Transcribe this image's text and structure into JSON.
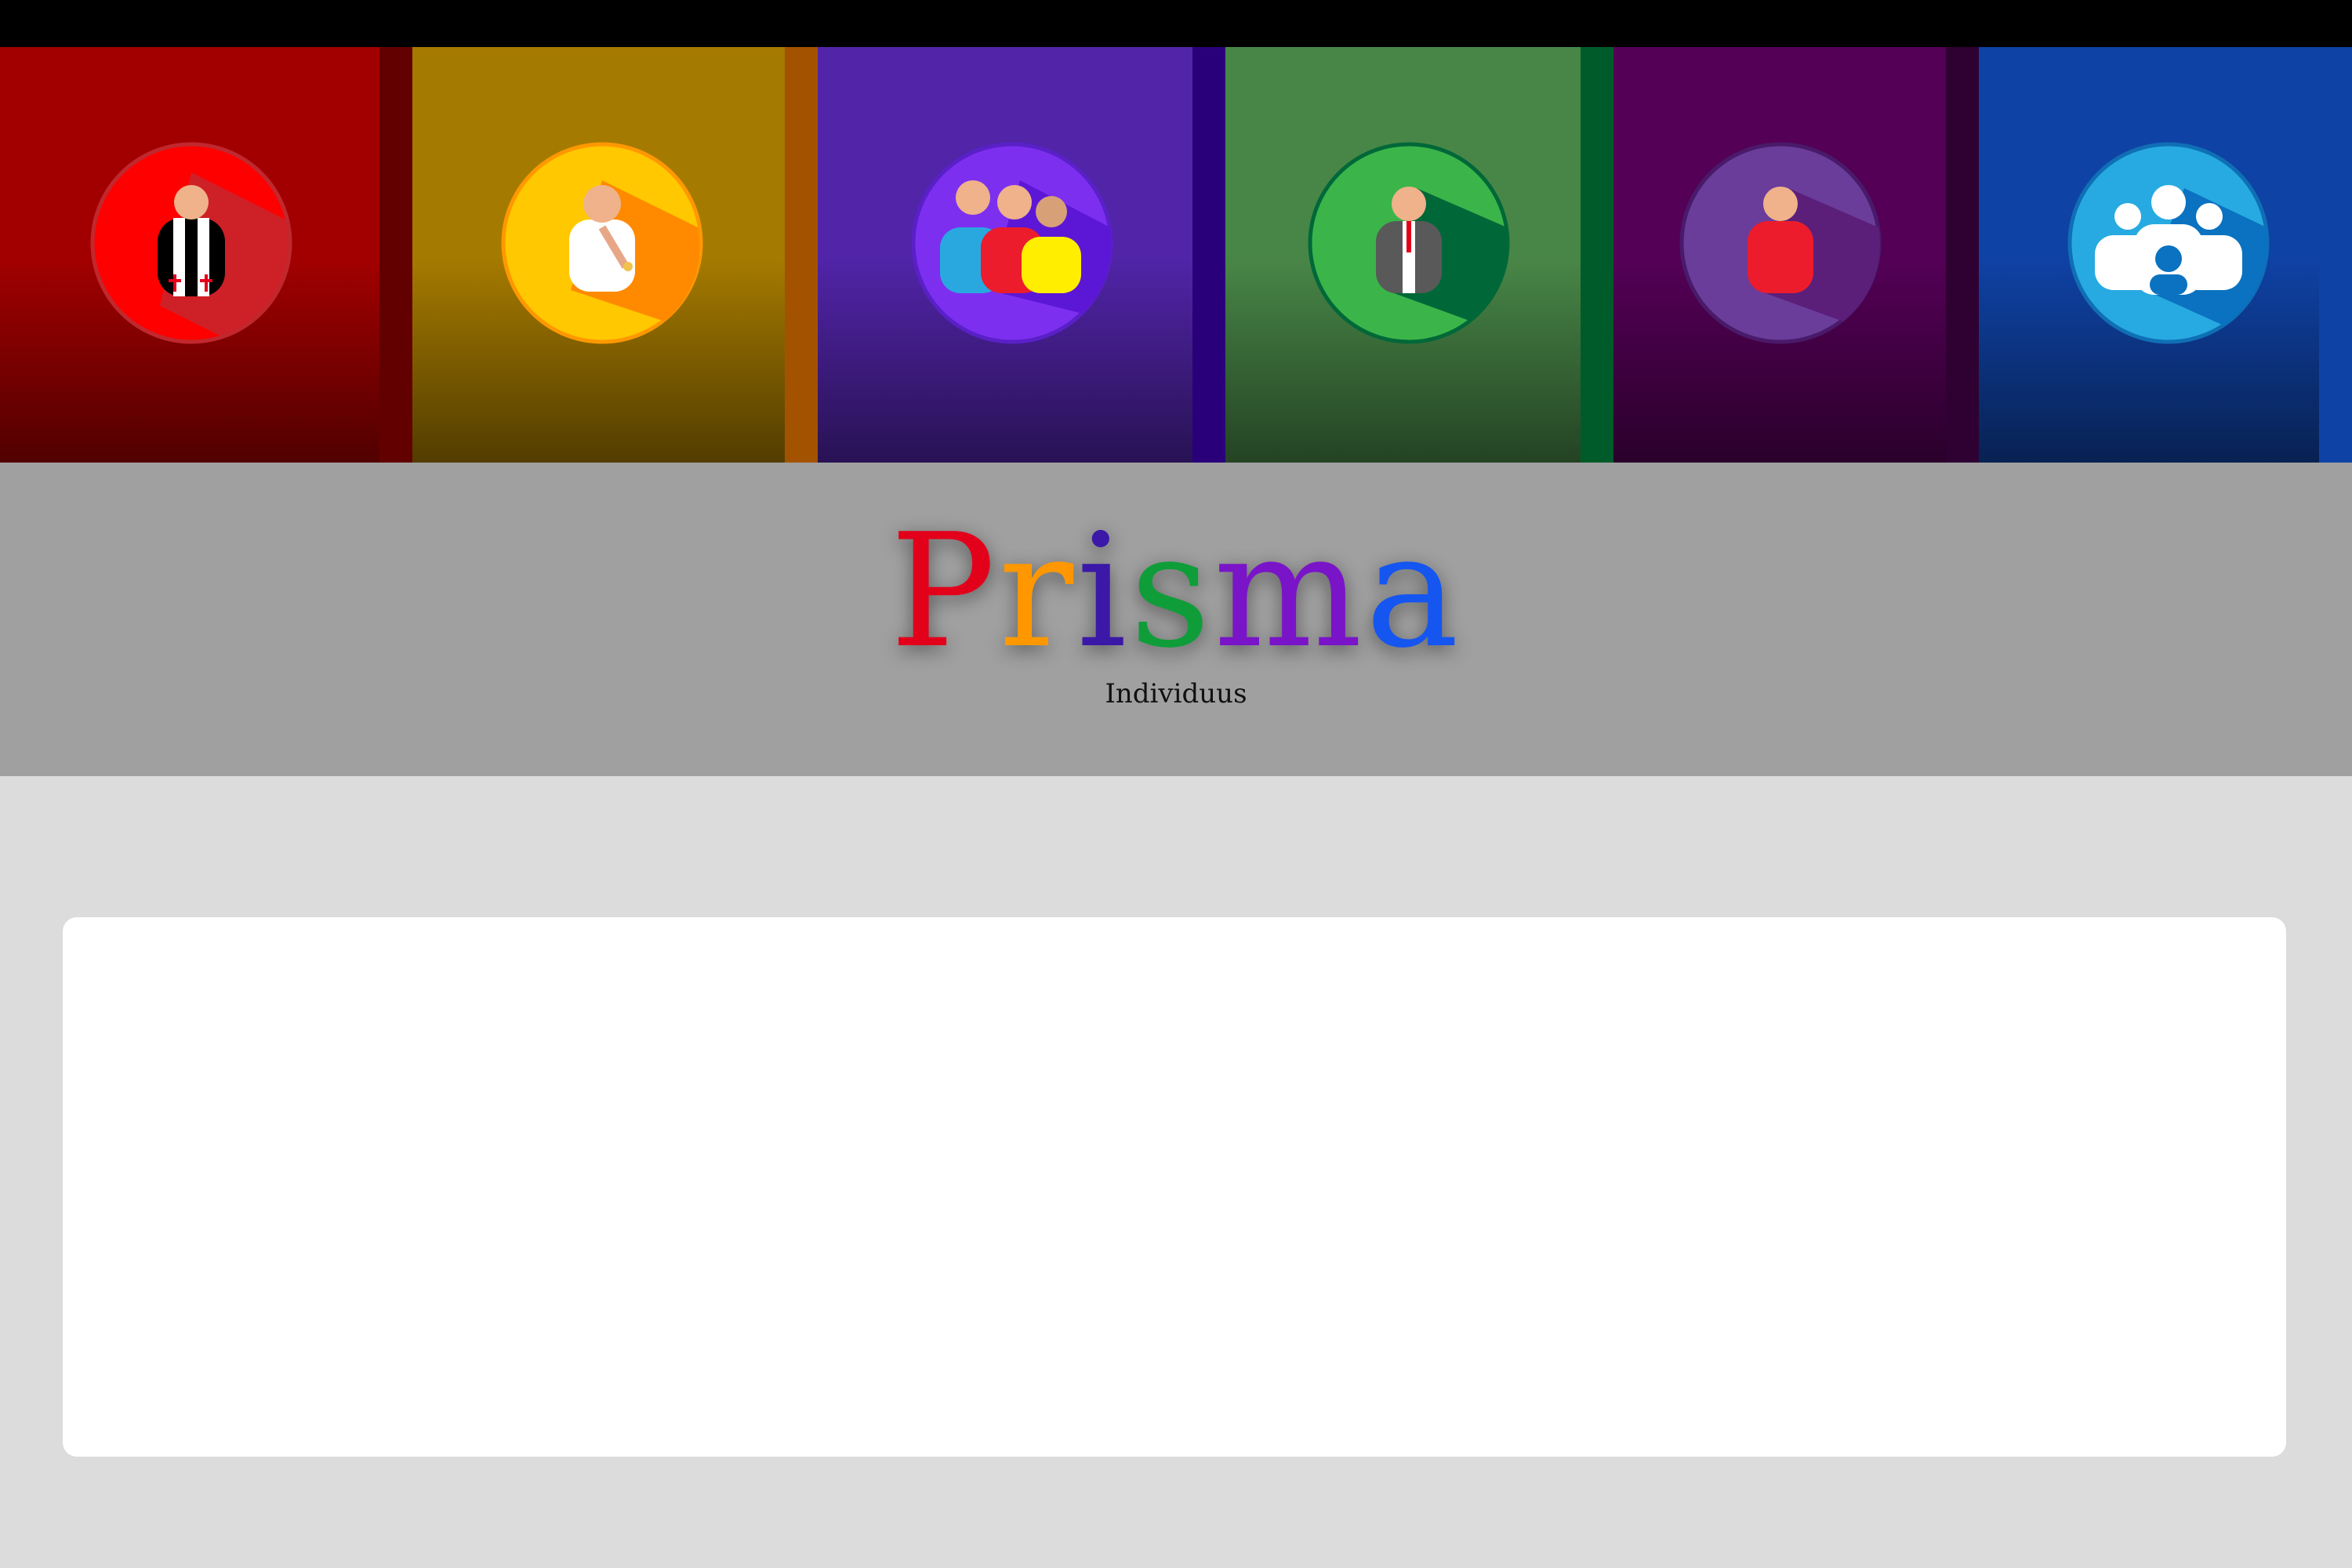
{
  "app": {
    "title": "Prisma",
    "subtitle": "Individuus"
  },
  "title_letter_colors": [
    "#e3001b",
    "#ff9800",
    "#3b18a8",
    "#0f9d3a",
    "#7a14c8",
    "#1556f0"
  ],
  "tiles": [
    {
      "name": "clergy",
      "icon": "clergy-person-icon",
      "bg": "#a20000",
      "edge": "#620000"
    },
    {
      "name": "baby",
      "icon": "baby-icon",
      "bg": "#a57a00",
      "edge": "#a35300"
    },
    {
      "name": "family",
      "icon": "family-icon",
      "bg": "#5124a8",
      "edge": "#2a007a"
    },
    {
      "name": "businessman",
      "icon": "businessman-icon",
      "bg": "#488647",
      "edge": "#005b2a"
    },
    {
      "name": "person",
      "icon": "person-icon",
      "bg": "#540056",
      "edge": "#2f0032"
    },
    {
      "name": "community",
      "icon": "community-icon",
      "bg": "#0f42a5",
      "edge": "#0f42a5"
    }
  ]
}
